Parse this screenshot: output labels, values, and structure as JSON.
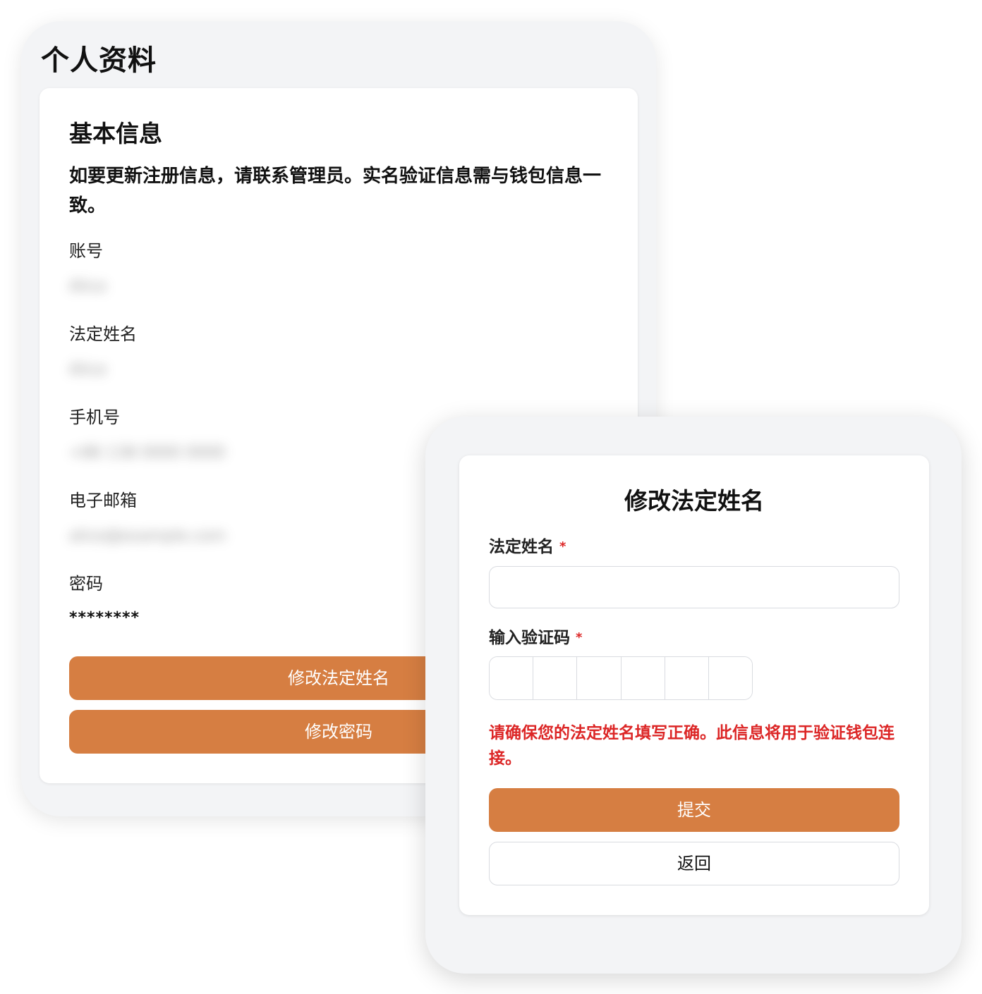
{
  "profile": {
    "page_title": "个人资料",
    "section_title": "基本信息",
    "description": "如要更新注册信息，请联系管理员。实名验证信息需与钱包信息一致。",
    "fields": [
      {
        "label": "账号",
        "value": "Alice"
      },
      {
        "label": "法定姓名",
        "value": "Alice"
      },
      {
        "label": "手机号",
        "value": "+86 138 0000 0000"
      },
      {
        "label": "电子邮箱",
        "value": "alice@example.com"
      },
      {
        "label": "密码",
        "value": "********"
      }
    ],
    "buttons": {
      "change_legal_name": "修改法定姓名",
      "change_password": "修改密码"
    }
  },
  "modal": {
    "title": "修改法定姓名",
    "legal_name_label": "法定姓名",
    "legal_name_value": "",
    "code_label": "输入验证码",
    "required_mark": "*",
    "code_cells": [
      "",
      "",
      "",
      "",
      "",
      ""
    ],
    "warning": "请确保您的法定姓名填写正确。此信息将用于验证钱包连接。",
    "submit_label": "提交",
    "back_label": "返回"
  },
  "colors": {
    "accent": "#d67e42",
    "warning": "#dc2626",
    "panel_bg": "#f3f4f6",
    "card_bg": "#ffffff"
  }
}
